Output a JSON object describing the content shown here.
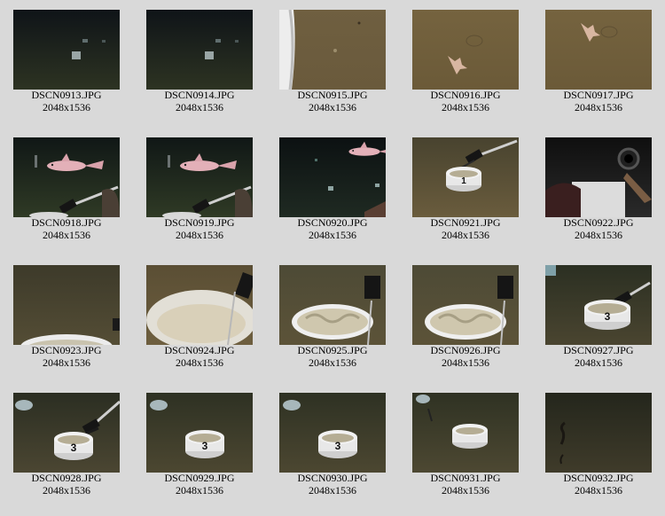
{
  "gallery": {
    "items": [
      {
        "name": "DSCN0913.JPG",
        "dims": "2048x1536",
        "scene": "dark-seafloor-distant-objects"
      },
      {
        "name": "DSCN0914.JPG",
        "dims": "2048x1536",
        "scene": "dark-seafloor-distant-objects"
      },
      {
        "name": "DSCN0915.JPG",
        "dims": "2048x1536",
        "scene": "sediment-with-bucket-edge"
      },
      {
        "name": "DSCN0916.JPG",
        "dims": "2048x1536",
        "scene": "sediment-with-pink-creature"
      },
      {
        "name": "DSCN0917.JPG",
        "dims": "2048x1536",
        "scene": "sediment-with-pink-creature"
      },
      {
        "name": "DSCN0918.JPG",
        "dims": "2048x1536",
        "scene": "pink-fish-with-arm"
      },
      {
        "name": "DSCN0919.JPG",
        "dims": "2048x1536",
        "scene": "pink-fish-with-arm"
      },
      {
        "name": "DSCN0920.JPG",
        "dims": "2048x1536",
        "scene": "pink-fish-dark-markers"
      },
      {
        "name": "DSCN0921.JPG",
        "dims": "2048x1536",
        "scene": "white-pot-held-by-arm"
      },
      {
        "name": "DSCN0922.JPG",
        "dims": "2048x1536",
        "scene": "machinery-closeup"
      },
      {
        "name": "DSCN0923.JPG",
        "dims": "2048x1536",
        "scene": "pot-rim-bottom"
      },
      {
        "name": "DSCN0924.JPG",
        "dims": "2048x1536",
        "scene": "pot-interior-closeup"
      },
      {
        "name": "DSCN0925.JPG",
        "dims": "2048x1536",
        "scene": "pot-filled-sediment"
      },
      {
        "name": "DSCN0926.JPG",
        "dims": "2048x1536",
        "scene": "pot-filled-sediment"
      },
      {
        "name": "DSCN0927.JPG",
        "dims": "2048x1536",
        "scene": "pot-number-3-with-arm"
      },
      {
        "name": "DSCN0928.JPG",
        "dims": "2048x1536",
        "scene": "pot-number-3-arm-releasing"
      },
      {
        "name": "DSCN0929.JPG",
        "dims": "2048x1536",
        "scene": "pot-number-3-on-floor"
      },
      {
        "name": "DSCN0930.JPG",
        "dims": "2048x1536",
        "scene": "pot-number-3-on-floor"
      },
      {
        "name": "DSCN0931.JPG",
        "dims": "2048x1536",
        "scene": "pot-on-floor-small"
      },
      {
        "name": "DSCN0932.JPG",
        "dims": "2048x1536",
        "scene": "empty-seafloor"
      }
    ]
  },
  "colors": {
    "page_background": "#d9d9d9",
    "caption_text": "#000000"
  }
}
